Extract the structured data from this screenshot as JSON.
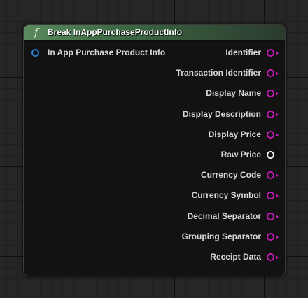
{
  "node": {
    "title": "Break InAppPurchaseProductInfo",
    "icon": "function-icon",
    "header_color": "#5b8a5e",
    "input": {
      "label": "In App Purchase Product Info",
      "pin_color": "#2a7fd4"
    },
    "outputs": [
      {
        "label": "Identifier",
        "pin_color": "#c01ab5",
        "type": "string"
      },
      {
        "label": "Transaction Identifier",
        "pin_color": "#c01ab5",
        "type": "string"
      },
      {
        "label": "Display Name",
        "pin_color": "#c01ab5",
        "type": "string"
      },
      {
        "label": "Display Description",
        "pin_color": "#c01ab5",
        "type": "string"
      },
      {
        "label": "Display Price",
        "pin_color": "#c01ab5",
        "type": "string"
      },
      {
        "label": "Raw Price",
        "pin_color": "#f0f0f0",
        "type": "wildcard"
      },
      {
        "label": "Currency Code",
        "pin_color": "#c01ab5",
        "type": "string"
      },
      {
        "label": "Currency Symbol",
        "pin_color": "#c01ab5",
        "type": "string"
      },
      {
        "label": "Decimal Separator",
        "pin_color": "#c01ab5",
        "type": "string"
      },
      {
        "label": "Grouping Separator",
        "pin_color": "#c01ab5",
        "type": "string"
      },
      {
        "label": "Receipt Data",
        "pin_color": "#c01ab5",
        "type": "string"
      }
    ]
  }
}
